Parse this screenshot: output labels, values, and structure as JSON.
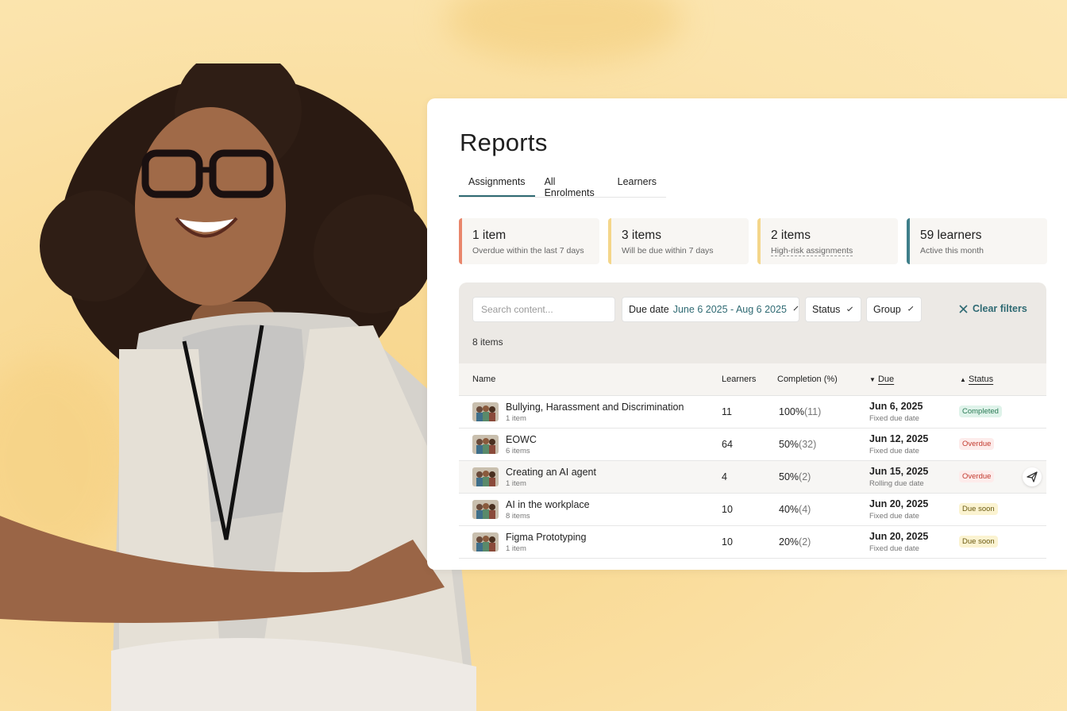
{
  "page": {
    "title": "Reports"
  },
  "tabs": [
    {
      "label": "Assignments",
      "active": true
    },
    {
      "label": "All Enrolments",
      "active": false
    },
    {
      "label": "Learners",
      "active": false
    }
  ],
  "stats": [
    {
      "value": "1 item",
      "sub": "Overdue within the last 7 days",
      "color": "#e9866b"
    },
    {
      "value": "3 items",
      "sub": "Will be due within 7 days",
      "color": "#f4d68a"
    },
    {
      "value": "2 items",
      "sub": "High-risk assignments",
      "color": "#f4d68a"
    },
    {
      "value": "59 learners",
      "sub": "Active this month",
      "color": "#3f7f8a"
    }
  ],
  "filters": {
    "search_placeholder": "Search content...",
    "due_label": "Due date",
    "due_range": "June 6 2025 - Aug 6 2025",
    "status_label": "Status",
    "group_label": "Group",
    "clear_label": "Clear filters",
    "count": "8 items"
  },
  "table": {
    "headers": {
      "name": "Name",
      "learners": "Learners",
      "completion": "Completion (%)",
      "due": "Due",
      "status": "Status"
    },
    "rows": [
      {
        "name": "Bullying, Harassment and Discrimination",
        "sub": "1 item",
        "learners": "11",
        "completion": "100%",
        "count": "(11)",
        "due": "Jun 6, 2025",
        "due_sub": "Fixed due date",
        "status": "Completed",
        "status_class": "b-completed"
      },
      {
        "name": "EOWC",
        "sub": "6 items",
        "learners": "64",
        "completion": "50%",
        "count": "(32)",
        "due": "Jun 12, 2025",
        "due_sub": "Fixed due date",
        "status": "Overdue",
        "status_class": "b-overdue"
      },
      {
        "name": "Creating an AI agent",
        "sub": "1 item",
        "learners": "4",
        "completion": "50%",
        "count": "(2)",
        "due": "Jun 15, 2025",
        "due_sub": "Rolling due date",
        "status": "Overdue",
        "status_class": "b-overdue"
      },
      {
        "name": "AI in the workplace",
        "sub": "8 items",
        "learners": "10",
        "completion": "40%",
        "count": "(4)",
        "due": "Jun 20, 2025",
        "due_sub": "Fixed due date",
        "status": "Due soon",
        "status_class": "b-duesoon"
      },
      {
        "name": "Figma Prototyping",
        "sub": "1 item",
        "learners": "10",
        "completion": "20%",
        "count": "(2)",
        "due": "Jun 20, 2025",
        "due_sub": "Fixed due date",
        "status": "Due soon",
        "status_class": "b-duesoon"
      }
    ]
  },
  "icons": {
    "send": "send-icon",
    "close": "close-icon",
    "chevron": "chevron-down-icon"
  }
}
